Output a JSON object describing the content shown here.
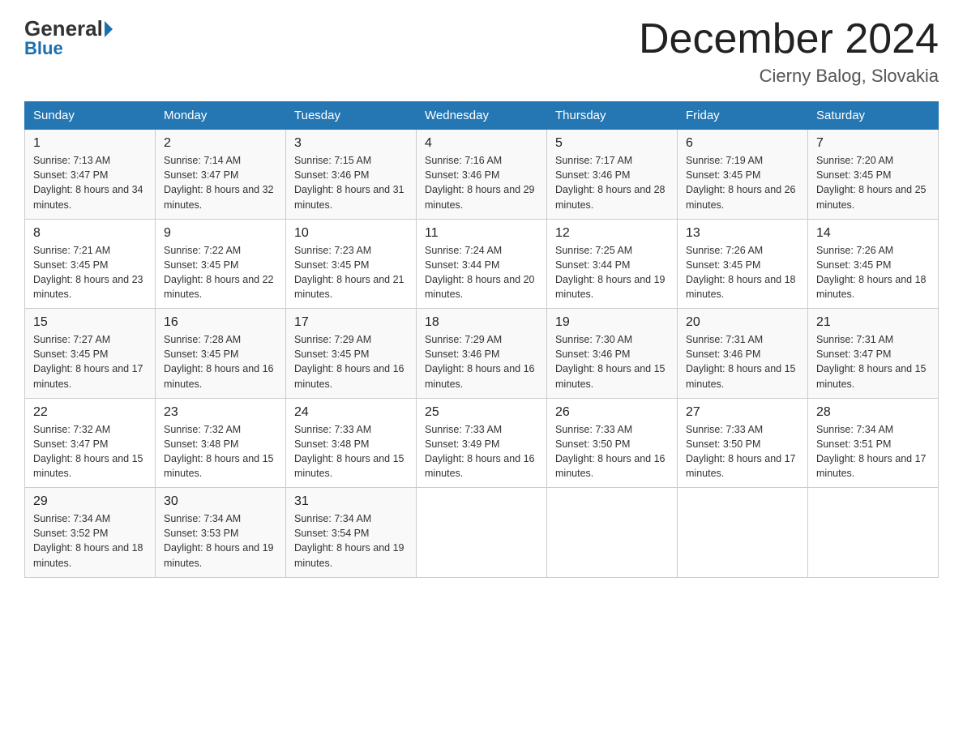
{
  "header": {
    "logo_general": "General",
    "logo_blue": "Blue",
    "month_title": "December 2024",
    "location": "Cierny Balog, Slovakia"
  },
  "columns": [
    "Sunday",
    "Monday",
    "Tuesday",
    "Wednesday",
    "Thursday",
    "Friday",
    "Saturday"
  ],
  "weeks": [
    [
      {
        "day": "1",
        "sunrise": "7:13 AM",
        "sunset": "3:47 PM",
        "daylight": "8 hours and 34 minutes."
      },
      {
        "day": "2",
        "sunrise": "7:14 AM",
        "sunset": "3:47 PM",
        "daylight": "8 hours and 32 minutes."
      },
      {
        "day": "3",
        "sunrise": "7:15 AM",
        "sunset": "3:46 PM",
        "daylight": "8 hours and 31 minutes."
      },
      {
        "day": "4",
        "sunrise": "7:16 AM",
        "sunset": "3:46 PM",
        "daylight": "8 hours and 29 minutes."
      },
      {
        "day": "5",
        "sunrise": "7:17 AM",
        "sunset": "3:46 PM",
        "daylight": "8 hours and 28 minutes."
      },
      {
        "day": "6",
        "sunrise": "7:19 AM",
        "sunset": "3:45 PM",
        "daylight": "8 hours and 26 minutes."
      },
      {
        "day": "7",
        "sunrise": "7:20 AM",
        "sunset": "3:45 PM",
        "daylight": "8 hours and 25 minutes."
      }
    ],
    [
      {
        "day": "8",
        "sunrise": "7:21 AM",
        "sunset": "3:45 PM",
        "daylight": "8 hours and 23 minutes."
      },
      {
        "day": "9",
        "sunrise": "7:22 AM",
        "sunset": "3:45 PM",
        "daylight": "8 hours and 22 minutes."
      },
      {
        "day": "10",
        "sunrise": "7:23 AM",
        "sunset": "3:45 PM",
        "daylight": "8 hours and 21 minutes."
      },
      {
        "day": "11",
        "sunrise": "7:24 AM",
        "sunset": "3:44 PM",
        "daylight": "8 hours and 20 minutes."
      },
      {
        "day": "12",
        "sunrise": "7:25 AM",
        "sunset": "3:44 PM",
        "daylight": "8 hours and 19 minutes."
      },
      {
        "day": "13",
        "sunrise": "7:26 AM",
        "sunset": "3:45 PM",
        "daylight": "8 hours and 18 minutes."
      },
      {
        "day": "14",
        "sunrise": "7:26 AM",
        "sunset": "3:45 PM",
        "daylight": "8 hours and 18 minutes."
      }
    ],
    [
      {
        "day": "15",
        "sunrise": "7:27 AM",
        "sunset": "3:45 PM",
        "daylight": "8 hours and 17 minutes."
      },
      {
        "day": "16",
        "sunrise": "7:28 AM",
        "sunset": "3:45 PM",
        "daylight": "8 hours and 16 minutes."
      },
      {
        "day": "17",
        "sunrise": "7:29 AM",
        "sunset": "3:45 PM",
        "daylight": "8 hours and 16 minutes."
      },
      {
        "day": "18",
        "sunrise": "7:29 AM",
        "sunset": "3:46 PM",
        "daylight": "8 hours and 16 minutes."
      },
      {
        "day": "19",
        "sunrise": "7:30 AM",
        "sunset": "3:46 PM",
        "daylight": "8 hours and 15 minutes."
      },
      {
        "day": "20",
        "sunrise": "7:31 AM",
        "sunset": "3:46 PM",
        "daylight": "8 hours and 15 minutes."
      },
      {
        "day": "21",
        "sunrise": "7:31 AM",
        "sunset": "3:47 PM",
        "daylight": "8 hours and 15 minutes."
      }
    ],
    [
      {
        "day": "22",
        "sunrise": "7:32 AM",
        "sunset": "3:47 PM",
        "daylight": "8 hours and 15 minutes."
      },
      {
        "day": "23",
        "sunrise": "7:32 AM",
        "sunset": "3:48 PM",
        "daylight": "8 hours and 15 minutes."
      },
      {
        "day": "24",
        "sunrise": "7:33 AM",
        "sunset": "3:48 PM",
        "daylight": "8 hours and 15 minutes."
      },
      {
        "day": "25",
        "sunrise": "7:33 AM",
        "sunset": "3:49 PM",
        "daylight": "8 hours and 16 minutes."
      },
      {
        "day": "26",
        "sunrise": "7:33 AM",
        "sunset": "3:50 PM",
        "daylight": "8 hours and 16 minutes."
      },
      {
        "day": "27",
        "sunrise": "7:33 AM",
        "sunset": "3:50 PM",
        "daylight": "8 hours and 17 minutes."
      },
      {
        "day": "28",
        "sunrise": "7:34 AM",
        "sunset": "3:51 PM",
        "daylight": "8 hours and 17 minutes."
      }
    ],
    [
      {
        "day": "29",
        "sunrise": "7:34 AM",
        "sunset": "3:52 PM",
        "daylight": "8 hours and 18 minutes."
      },
      {
        "day": "30",
        "sunrise": "7:34 AM",
        "sunset": "3:53 PM",
        "daylight": "8 hours and 19 minutes."
      },
      {
        "day": "31",
        "sunrise": "7:34 AM",
        "sunset": "3:54 PM",
        "daylight": "8 hours and 19 minutes."
      },
      null,
      null,
      null,
      null
    ]
  ]
}
